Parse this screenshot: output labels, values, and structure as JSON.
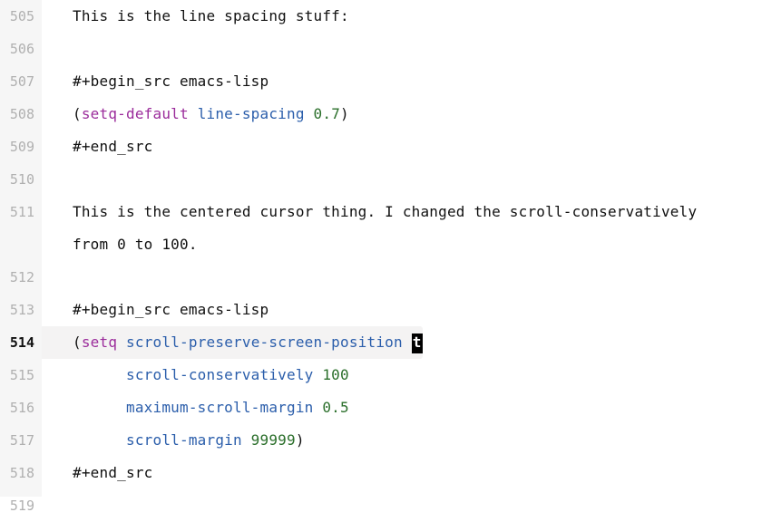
{
  "colors": {
    "keyword": "#9b2c9b",
    "symbol": "#2b5eab",
    "number": "#2b6f2b",
    "gutter_bg": "#f6f6f6",
    "gutter_fg": "#b0b0b0",
    "current_line_bg": "#f4f3f3"
  },
  "cursor": {
    "line": 514,
    "char": "t"
  },
  "lines": {
    "505": {
      "num": "505",
      "plain": "This is the line spacing stuff:"
    },
    "506": {
      "num": "506"
    },
    "507": {
      "num": "507",
      "directive": "#+begin_src emacs-lisp"
    },
    "508": {
      "num": "508",
      "open": "(",
      "kw": "setq-default",
      "sym": "line-spacing",
      "val": "0.7",
      "close": ")"
    },
    "509": {
      "num": "509",
      "directive": "#+end_src"
    },
    "510": {
      "num": "510"
    },
    "511": {
      "num": "511",
      "plain": "This is the centered cursor thing. I changed the scroll-conservatively from 0 to 100."
    },
    "512": {
      "num": "512"
    },
    "513": {
      "num": "513",
      "directive": "#+begin_src emacs-lisp"
    },
    "514": {
      "num": "514",
      "open": "(",
      "kw": "setq",
      "sym": "scroll-preserve-screen-position"
    },
    "515": {
      "num": "515",
      "indent": "      ",
      "sym": "scroll-conservatively",
      "val": "100"
    },
    "516": {
      "num": "516",
      "indent": "      ",
      "sym": "maximum-scroll-margin",
      "val": "0.5"
    },
    "517": {
      "num": "517",
      "indent": "      ",
      "sym": "scroll-margin",
      "val": "99999",
      "close": ")"
    },
    "518": {
      "num": "518",
      "directive": "#+end_src"
    },
    "519": {
      "num": "519"
    }
  }
}
